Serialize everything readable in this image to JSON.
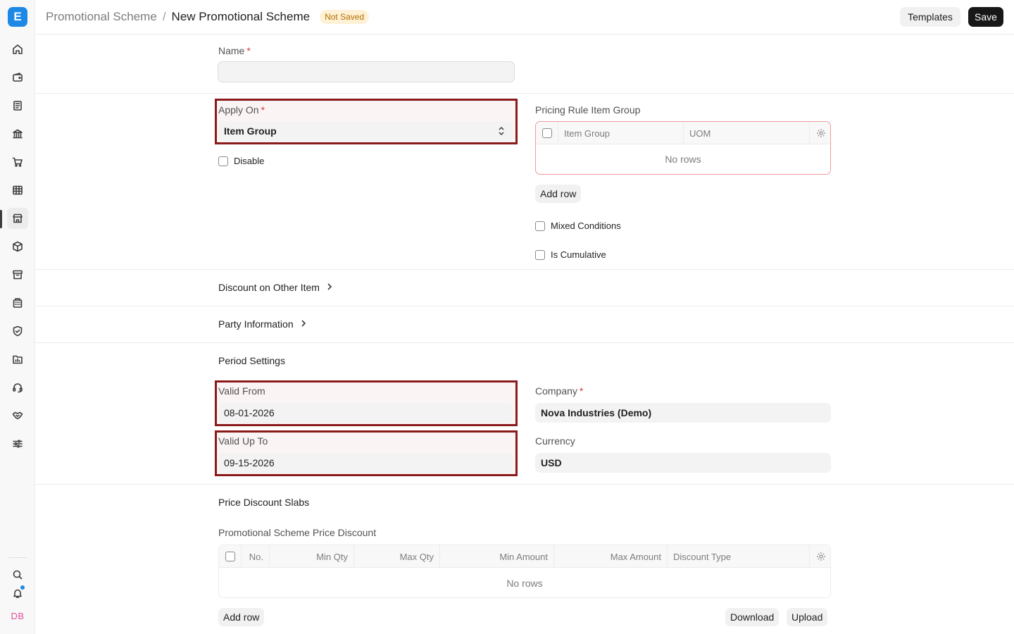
{
  "header": {
    "breadcrumb_parent": "Promotional Scheme",
    "breadcrumb_sep": "/",
    "title": "New Promotional Scheme",
    "status": "Not Saved",
    "templates_label": "Templates",
    "save_label": "Save"
  },
  "sidebar": {
    "logo": "E",
    "avatar": "DB",
    "items": [
      "home-icon",
      "wallet-icon",
      "document-icon",
      "bank-icon",
      "cart-icon",
      "table-icon",
      "store-icon",
      "package-icon",
      "archive-icon",
      "building-icon",
      "shield-icon",
      "folder-chart-icon",
      "headset-icon",
      "handshake-icon",
      "settings-sliders-icon"
    ],
    "bottom": [
      "search-icon",
      "bell-icon"
    ]
  },
  "form": {
    "name_label": "Name",
    "name_value": "",
    "apply_on_label": "Apply On",
    "apply_on_value": "Item Group",
    "disable_label": "Disable",
    "pricing_rule_item_group_label": "Pricing Rule Item Group",
    "item_group_table": {
      "columns": [
        "Item Group",
        "UOM"
      ],
      "empty": "No rows",
      "add_row": "Add row"
    },
    "mixed_conditions_label": "Mixed Conditions",
    "is_cumulative_label": "Is Cumulative",
    "discount_other_item_label": "Discount on Other Item",
    "party_information_label": "Party Information",
    "period_settings_label": "Period Settings",
    "valid_from_label": "Valid From",
    "valid_from_value": "08-01-2026",
    "valid_upto_label": "Valid Up To",
    "valid_upto_value": "09-15-2026",
    "company_label": "Company",
    "company_value": "Nova Industries (Demo)",
    "currency_label": "Currency",
    "currency_value": "USD",
    "price_discount_slabs_label": "Price Discount Slabs",
    "promo_price_discount_label": "Promotional Scheme Price Discount",
    "price_discount_table": {
      "columns": [
        "No.",
        "Min Qty",
        "Max Qty",
        "Min Amount",
        "Max Amount",
        "Discount Type"
      ],
      "empty": "No rows",
      "add_row": "Add row",
      "download": "Download",
      "upload": "Upload"
    },
    "required_mark": "*"
  }
}
